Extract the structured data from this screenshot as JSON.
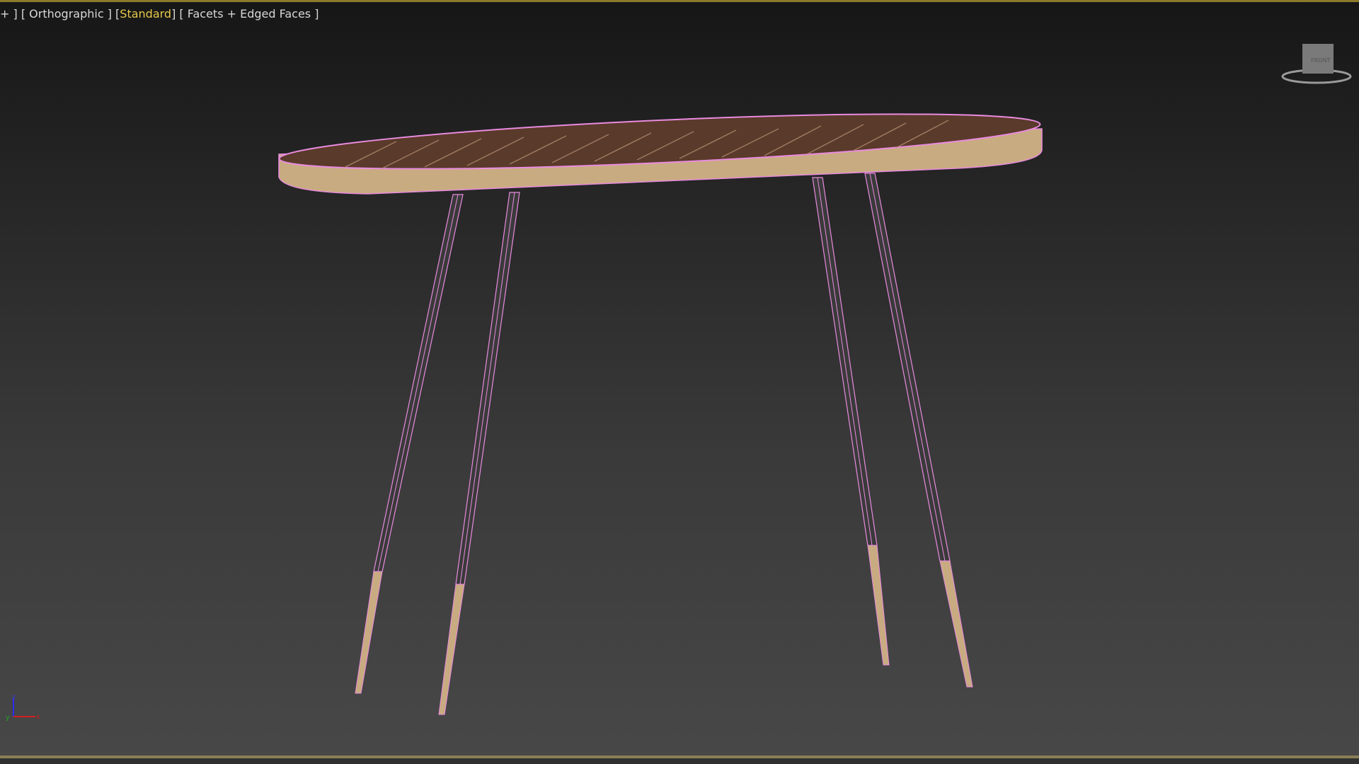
{
  "viewport": {
    "menu_plus": "+ ]",
    "view_label": "[ Orthographic ]",
    "shading_open": "[",
    "shading_label": "Standard",
    "shading_close": "]",
    "display_label": "[ Facets + Edged Faces ]"
  },
  "viewcube": {
    "face_label": "FRONT"
  },
  "axis_gizmo": {
    "x": "x",
    "y": "y",
    "z": "z"
  },
  "colors": {
    "wire": "#e98be0",
    "wood": "#c8ab80",
    "top": "#5a3a2a",
    "accent": "#e6c84a"
  }
}
